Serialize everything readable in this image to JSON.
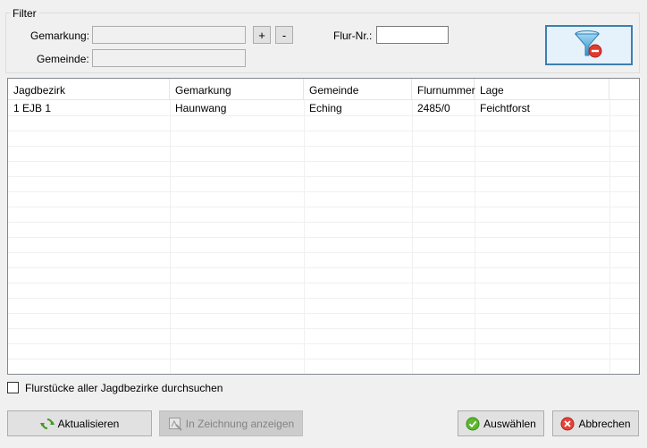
{
  "filter": {
    "group_label": "Filter",
    "gemarkung_label": "Gemarkung:",
    "gemarkung_value": "",
    "gemeinde_label": "Gemeinde:",
    "gemeinde_value": "",
    "add_label": "+",
    "remove_label": "-",
    "flur_label": "Flur-Nr.:",
    "flur_value": "",
    "clear_filter_icon": "funnel-remove-icon"
  },
  "grid": {
    "columns": [
      "Jagdbezirk",
      "Gemarkung",
      "Gemeinde",
      "Flurnummer",
      "Lage"
    ],
    "rows": [
      [
        "1 EJB 1",
        "Haunwang",
        "Eching",
        "2485/0",
        "Feichtforst"
      ]
    ]
  },
  "options": {
    "search_all_label": "Flurstücke aller Jagdbezirke durchsuchen",
    "search_all_checked": false
  },
  "buttons": {
    "refresh_label": "Aktualisieren",
    "show_in_drawing_label": "In Zeichnung anzeigen",
    "select_label": "Auswählen",
    "cancel_label": "Abbrechen"
  },
  "colors": {
    "accent_border": "#3c7fb1",
    "ok_green": "#4caf2a",
    "cancel_red": "#d9322a"
  }
}
